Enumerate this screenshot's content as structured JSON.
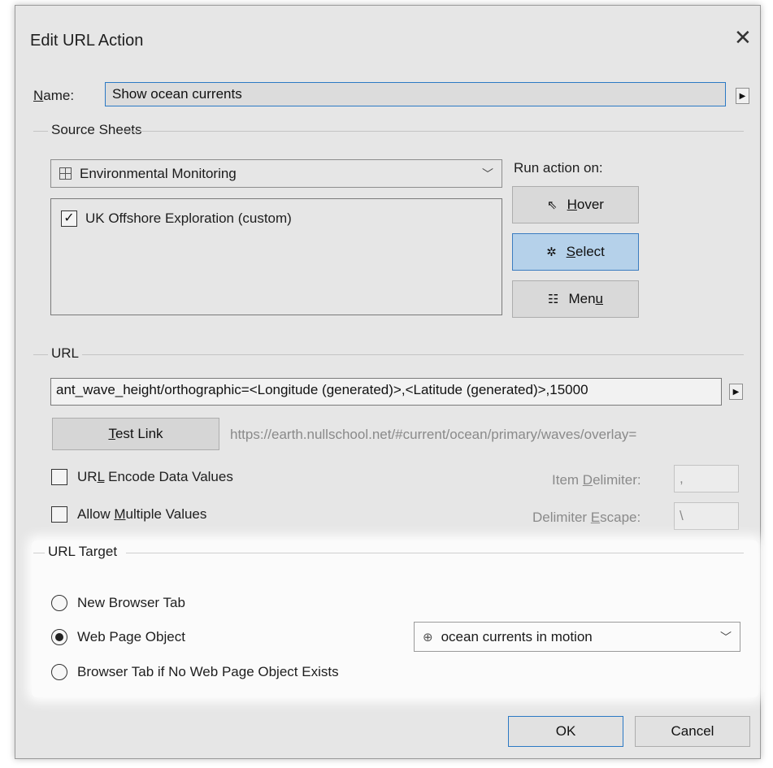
{
  "dialog": {
    "title": "Edit URL Action",
    "close_icon": "close-icon"
  },
  "name": {
    "label_prefix": "N",
    "label_rest": "ame:",
    "value": "Show ocean currents"
  },
  "source_sheets": {
    "heading": "Source Sheets",
    "dashboard": "Environmental Monitoring",
    "sheets": [
      {
        "label": "UK Offshore Exploration (custom)",
        "checked": true
      }
    ]
  },
  "run_action": {
    "label": "Run action on:",
    "buttons": [
      {
        "pre": "",
        "key": "H",
        "post": "over",
        "icon": "pointer-icon",
        "active": false
      },
      {
        "pre": "",
        "key": "S",
        "post": "elect",
        "icon": "select-cursor-icon",
        "active": true
      },
      {
        "pre": "Men",
        "key": "u",
        "post": "",
        "icon": "menu-cursor-icon",
        "active": false
      }
    ]
  },
  "url": {
    "heading": "URL",
    "value": "ant_wave_height/orthographic=<Longitude (generated)>,<Latitude (generated)>,15000",
    "test_link_key": "T",
    "test_link_rest": "est Link",
    "preview": "https://earth.nullschool.net/#current/ocean/primary/waves/overlay=",
    "encode": {
      "pre": "UR",
      "key": "L",
      "post": " Encode Data Values",
      "checked": false
    },
    "multiple": {
      "pre": "Allow ",
      "key": "M",
      "post": "ultiple Values",
      "checked": false
    },
    "item_delimiter": {
      "pre": "Item ",
      "key": "D",
      "post": "elimiter:",
      "value": ","
    },
    "delimiter_escape": {
      "pre": "Delimiter ",
      "key": "E",
      "post": "scape:",
      "value": "\\"
    }
  },
  "url_target": {
    "heading": "URL Target",
    "options": [
      {
        "label": "New Browser Tab",
        "selected": false
      },
      {
        "label": "Web Page Object",
        "selected": true
      },
      {
        "label": "Browser Tab if No Web Page Object Exists",
        "selected": false
      }
    ],
    "web_object": "ocean currents in motion"
  },
  "footer": {
    "ok": "OK",
    "cancel": "Cancel"
  },
  "colors": {
    "dialog_bg": "#e6e6e6",
    "accent": "#2b79c4",
    "active_button": "#b5d1ea"
  }
}
